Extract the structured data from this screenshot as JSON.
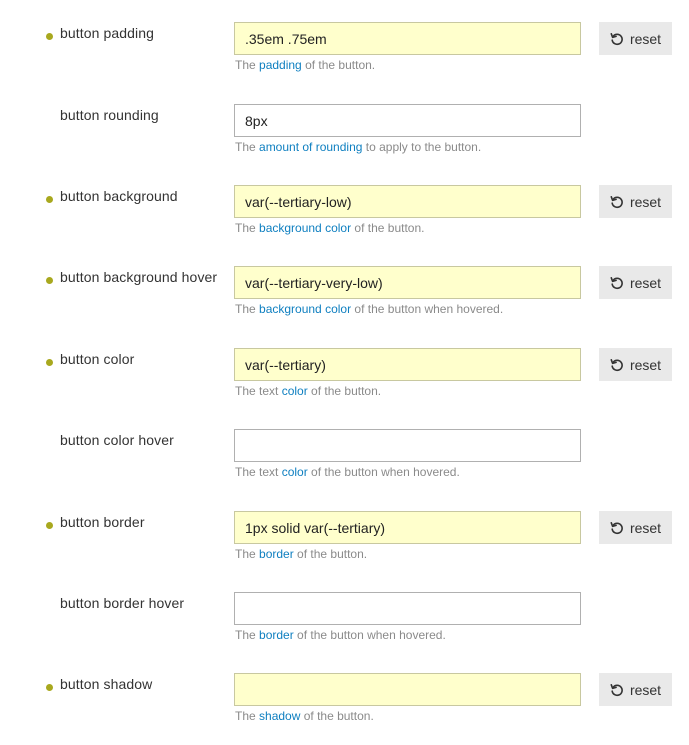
{
  "reset_label": "reset",
  "colors": {
    "changed_dot": "#a8a81e",
    "overridden_bg": "#ffffcc",
    "link": "#0e7fc0"
  },
  "settings": [
    {
      "label": "button padding",
      "value": ".35em .75em",
      "overridden": true,
      "desc": {
        "pre": "The ",
        "link": "padding",
        "post": " of the button."
      }
    },
    {
      "label": "button rounding",
      "value": "8px",
      "overridden": false,
      "desc": {
        "pre": "The ",
        "link": "amount of rounding",
        "post": " to apply to the button."
      }
    },
    {
      "label": "button background",
      "value": "var(--tertiary-low)",
      "overridden": true,
      "desc": {
        "pre": "The ",
        "link": "background color",
        "post": " of the button."
      }
    },
    {
      "label": "button background hover",
      "value": "var(--tertiary-very-low)",
      "overridden": true,
      "desc": {
        "pre": "The ",
        "link": "background color",
        "post": " of the button when hovered."
      }
    },
    {
      "label": "button color",
      "value": "var(--tertiary)",
      "overridden": true,
      "desc": {
        "pre": "The text ",
        "link": "color",
        "post": " of the button."
      }
    },
    {
      "label": "button color hover",
      "value": "",
      "overridden": false,
      "desc": {
        "pre": "The text ",
        "link": "color",
        "post": " of the button when hovered."
      }
    },
    {
      "label": "button border",
      "value": "1px solid var(--tertiary)",
      "overridden": true,
      "desc": {
        "pre": "The ",
        "link": "border",
        "post": " of the button."
      }
    },
    {
      "label": "button border hover",
      "value": "",
      "overridden": false,
      "desc": {
        "pre": "The ",
        "link": "border",
        "post": " of the button when hovered."
      }
    },
    {
      "label": "button shadow",
      "value": "",
      "overridden": true,
      "desc": {
        "pre": "The ",
        "link": "shadow",
        "post": " of the button."
      }
    }
  ]
}
